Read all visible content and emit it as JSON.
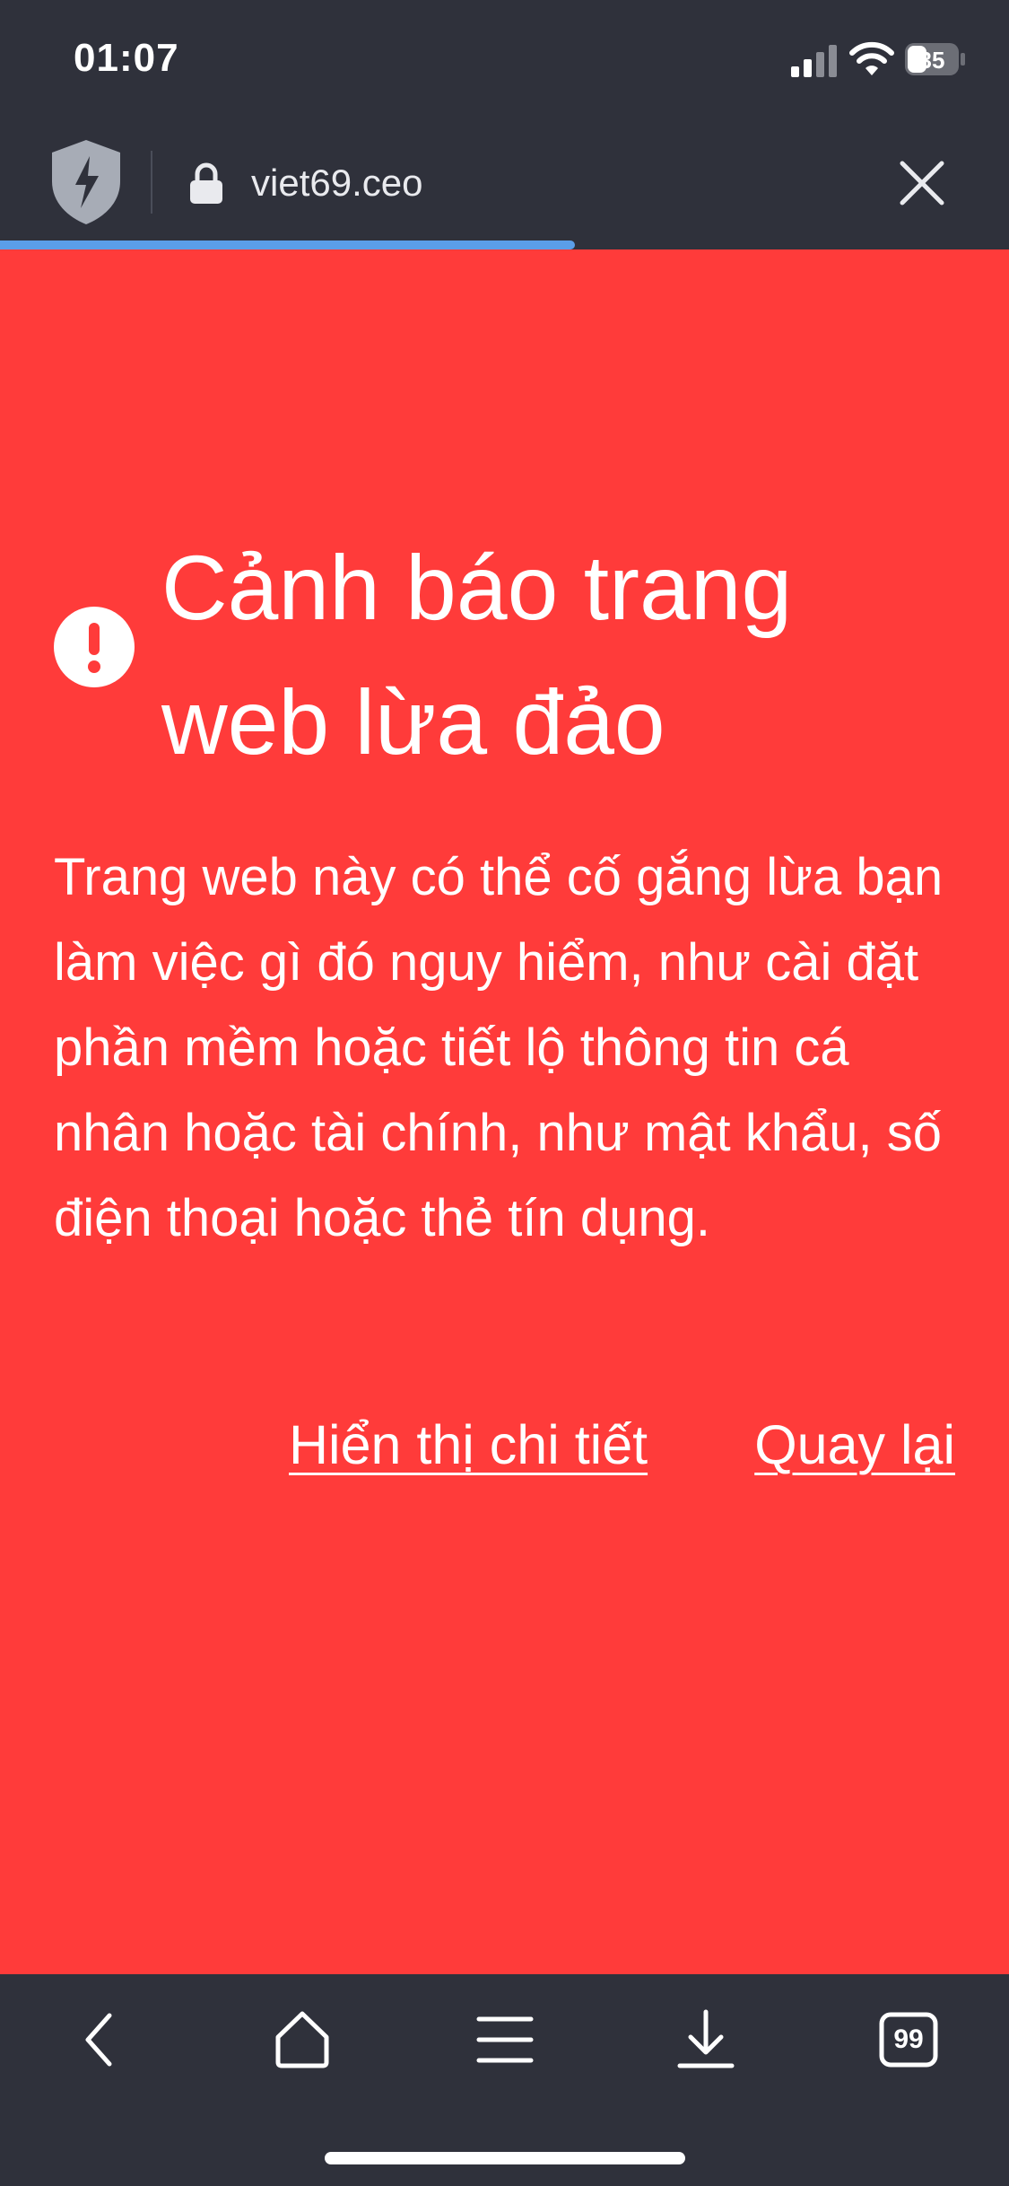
{
  "status_bar": {
    "time": "01:07",
    "battery": "35"
  },
  "address_bar": {
    "url": "viet69.ceo",
    "load_progress": 0.57
  },
  "warning": {
    "title": "Cảnh báo trang web lừa đảo",
    "body": "Trang web này có thể cố gắng lừa bạn làm việc gì đó nguy hiểm, như cài đặt phần mềm hoặc tiết lộ thông tin cá nhân hoặc tài chính, như mật khẩu, số điện thoại hoặc thẻ tín dụng.",
    "show_details_label": "Hiển thị chi tiết",
    "go_back_label": "Quay lại",
    "background_color": "#ff3b3a"
  },
  "toolbar": {
    "tabs_count": "99",
    "icons": [
      "back-icon",
      "home-icon",
      "menu-icon",
      "download-icon",
      "tabs-icon"
    ]
  },
  "colors": {
    "chrome": "#2f313b",
    "progress": "#5b9ee8",
    "text": "#ffffff"
  }
}
